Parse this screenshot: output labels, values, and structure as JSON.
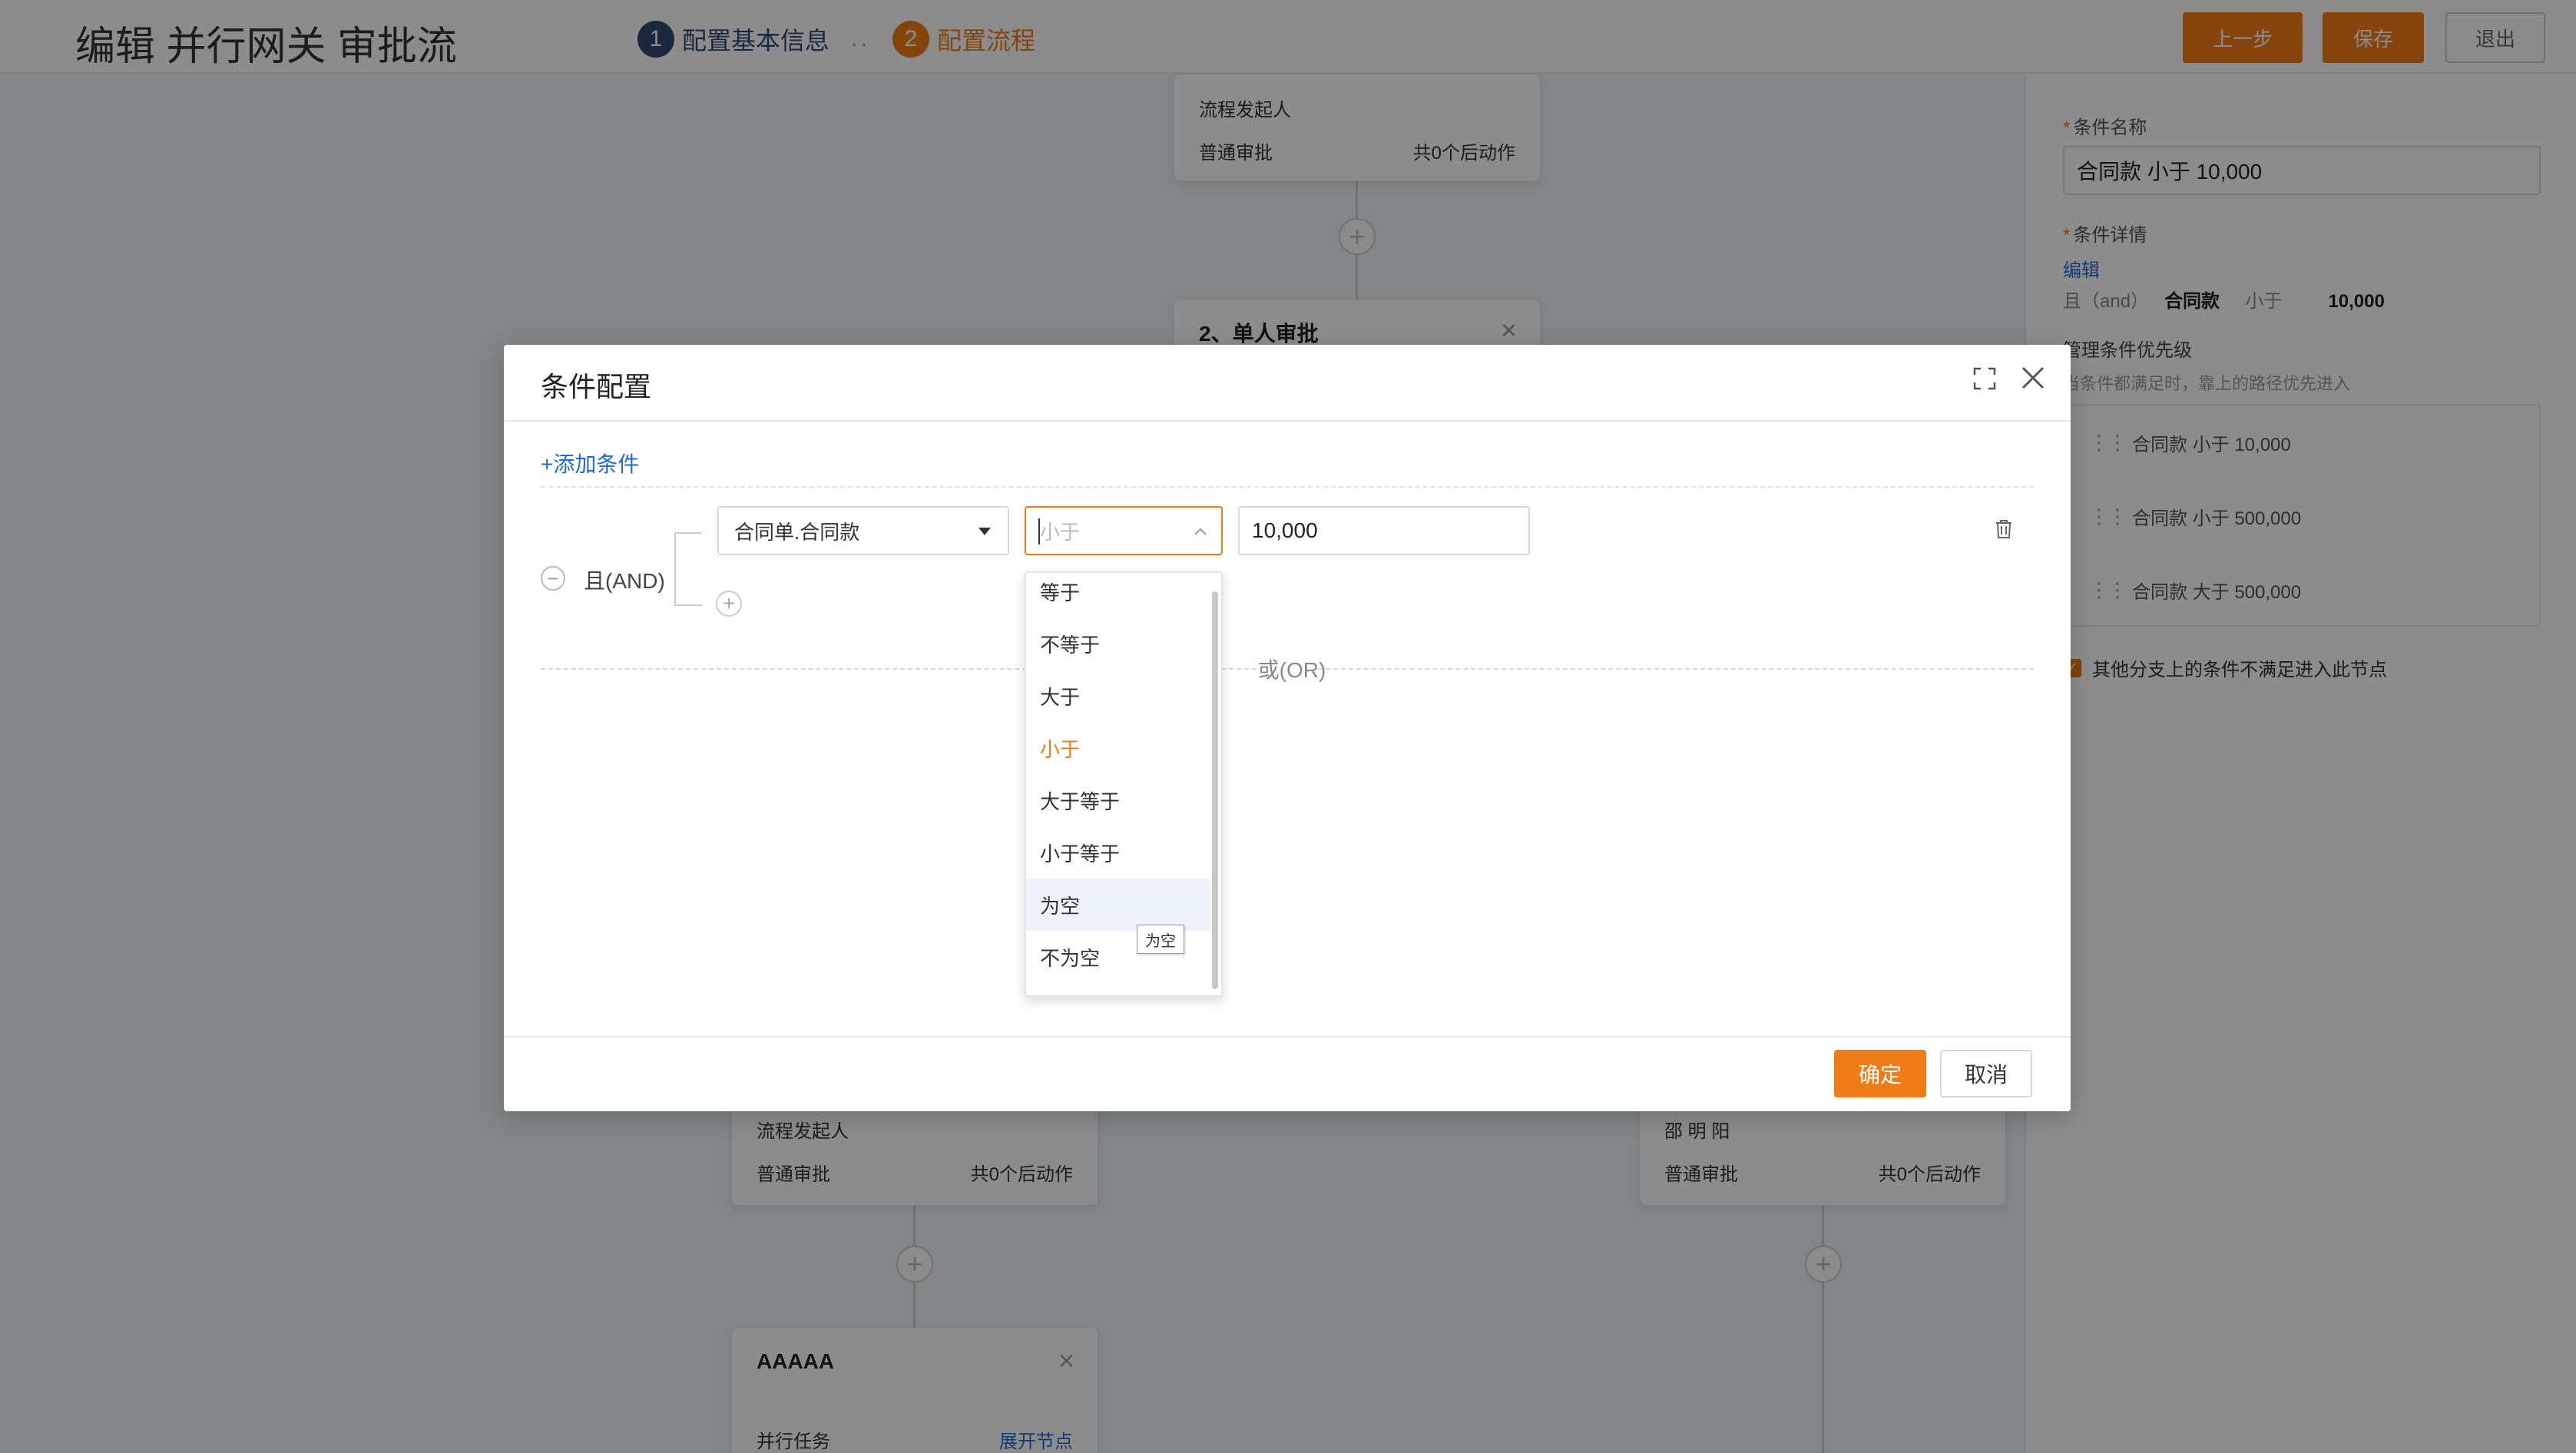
{
  "header": {
    "title": "编辑 并行网关 审批流",
    "steps": [
      {
        "num": "1",
        "label": "配置基本信息"
      },
      {
        "num": "2",
        "label": "配置流程"
      }
    ],
    "dots": "..",
    "prev_label": "上一步",
    "save_label": "保存",
    "exit_label": "退出"
  },
  "canvas": {
    "node_top": {
      "line1": "流程发起人",
      "type": "普通审批",
      "actions": "共0个后动作"
    },
    "node_single": {
      "title": "2、单人审批"
    },
    "node_left": {
      "line1": "流程发起人",
      "type": "普通审批",
      "actions": "共0个后动作"
    },
    "node_right": {
      "line1": "邵 明 阳",
      "type": "普通审批",
      "actions": "共0个后动作"
    },
    "node_aaaaa": {
      "title": "AAAAA",
      "type": "并行任务",
      "link": "展开节点"
    }
  },
  "right_panel": {
    "cond_name_label": "条件名称",
    "cond_name_value": "合同款 小于 10,000",
    "cond_detail_label": "条件详情",
    "edit_label": "编辑",
    "detail_and": "且（and）",
    "detail_field": "合同款",
    "detail_op": "小于",
    "detail_value": "10,000",
    "priority_label": "管理条件优先级",
    "priority_hint": "当条件都满足时，靠上的路径优先进入",
    "priority_items": [
      "合同款 小于 10,000",
      "合同款 小于 500,000",
      "合同款 大于 500,000"
    ],
    "else_label": "其他分支上的条件不满足进入此节点"
  },
  "modal": {
    "title": "条件配置",
    "add_condition": "+添加条件",
    "and_label": "且(AND)",
    "field_value": "合同单.合同款",
    "operator_placeholder": "小于",
    "value_input": "10,000",
    "or_label": "或(OR)",
    "ok_label": "确定",
    "cancel_label": "取消"
  },
  "dropdown": {
    "options": [
      "等于",
      "不等于",
      "大于",
      "小于",
      "大于等于",
      "小于等于",
      "为空",
      "不为空"
    ],
    "selected": "小于",
    "hovered": "为空",
    "tooltip": "为空"
  },
  "colors": {
    "accent": "#f07c17",
    "link": "#1e6ad6"
  }
}
